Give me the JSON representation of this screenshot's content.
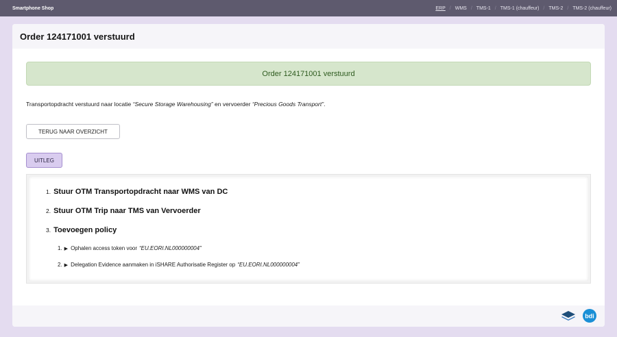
{
  "topbar": {
    "brand": "Smartphone Shop",
    "nav": [
      {
        "label": "ERP",
        "active": true
      },
      {
        "label": "WMS",
        "active": false
      },
      {
        "label": "TMS-1",
        "active": false
      },
      {
        "label": "TMS-1 (chauffeur)",
        "active": false
      },
      {
        "label": "TMS-2",
        "active": false
      },
      {
        "label": "TMS-2 (chauffeur)",
        "active": false
      }
    ]
  },
  "card": {
    "title": "Order 124171001 verstuurd"
  },
  "alert": {
    "message": "Order 124171001 verstuurd",
    "color": "#d6e6cc"
  },
  "info": {
    "prefix": "Transportopdracht verstuurd naar locatie ",
    "location": "“Secure Storage Warehousing”",
    "middle": " en vervoerder ",
    "carrier": "“Precious Goods Transport”",
    "suffix": "."
  },
  "buttons": {
    "back_label": "TERUG NAAR OVERZICHT",
    "uitleg_label": "UITLEG"
  },
  "explain": {
    "steps": [
      {
        "num": "1.",
        "text": "Stuur OTM Transportopdracht naar WMS van DC"
      },
      {
        "num": "2.",
        "text": "Stuur OTM Trip naar TMS van Vervoerder"
      },
      {
        "num": "3.",
        "text": "Toevoegen policy"
      }
    ],
    "substeps": [
      {
        "num": "1.",
        "marker": "▶",
        "text": "Ophalen access token voor",
        "ref": "“EU.EORI.NL000000004”"
      },
      {
        "num": "2.",
        "marker": "▶",
        "text": "Delegation Evidence aanmaken in iSHARE Authorisatie Register op",
        "ref": "“EU.EORI.NL000000004”"
      }
    ]
  },
  "footer": {
    "logos": [
      "layers-logo-icon",
      "bdi-logo-icon"
    ]
  },
  "colors": {
    "topbar": "#5e5a6e",
    "background": "#e4dcf0",
    "accent_button": "#d9ccef",
    "bdi_logo": "#1a8fd6"
  }
}
